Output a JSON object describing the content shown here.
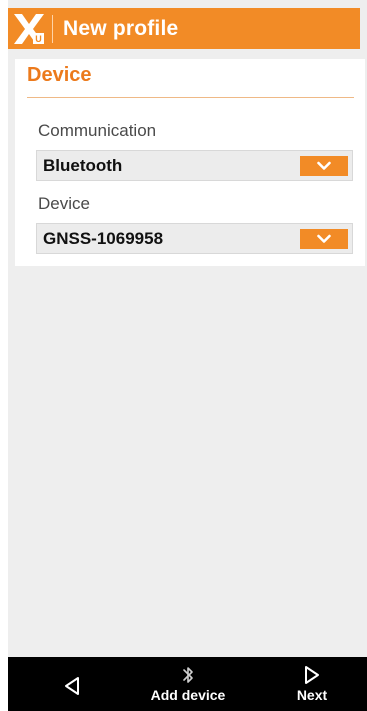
{
  "app": {
    "title": "New profile"
  },
  "section": {
    "title": "Device"
  },
  "fields": [
    {
      "label": "Communication",
      "value": "Bluetooth"
    },
    {
      "label": "Device",
      "value": "GNSS-1069958"
    }
  ],
  "bottom_bar": {
    "back_icon": "back-triangle-icon",
    "add_device_label": "Add device",
    "add_device_icon": "bluetooth-icon",
    "next_label": "Next",
    "next_icon": "play-triangle-icon"
  },
  "colors": {
    "accent": "#f28b26",
    "section_title": "#ec7a1c",
    "background": "#eeeeee",
    "bottom_bar": "#000000"
  }
}
